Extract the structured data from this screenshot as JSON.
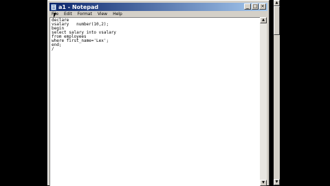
{
  "window": {
    "title": "a1 - Notepad",
    "minimize_glyph": "_",
    "maximize_glyph": "□",
    "close_glyph": "×"
  },
  "menu": {
    "items": [
      "File",
      "Edit",
      "Format",
      "View",
      "Help"
    ]
  },
  "editor": {
    "lines": [
      "declare",
      "vsalary   number(10,2);",
      "begin",
      "select salary into vsalary",
      "from employees",
      "where first_name='Lex';",
      "end;",
      "/"
    ]
  },
  "scrollbar": {
    "up_glyph": "▲",
    "down_glyph": "▼"
  },
  "colors": {
    "desktop": "#000000",
    "titlebar_start": "#0a246a",
    "titlebar_end": "#a6caf0",
    "chrome": "#d4d0c8"
  }
}
